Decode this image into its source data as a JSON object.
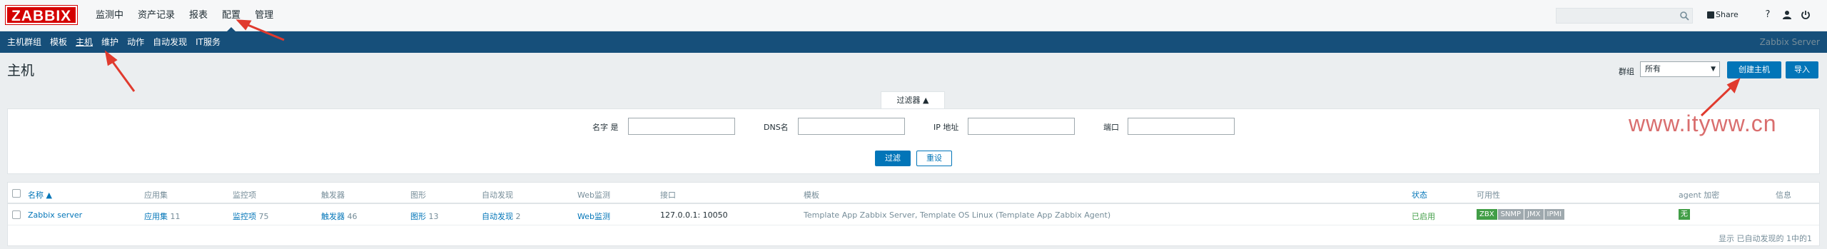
{
  "app": {
    "logo": "ZABBIX",
    "server_name": "Zabbix Server"
  },
  "topnav": [
    {
      "label": "监测中"
    },
    {
      "label": "资产记录"
    },
    {
      "label": "报表"
    },
    {
      "label": "配置",
      "active": true
    },
    {
      "label": "管理"
    }
  ],
  "header_tools": {
    "search_placeholder": "",
    "share_label": "Share",
    "help_icon": "?",
    "user_icon": "user-icon",
    "power_icon": "power-icon"
  },
  "subnav": [
    {
      "label": "主机群组"
    },
    {
      "label": "模板"
    },
    {
      "label": "主机",
      "active": true
    },
    {
      "label": "维护"
    },
    {
      "label": "动作"
    },
    {
      "label": "自动发现"
    },
    {
      "label": "IT服务"
    }
  ],
  "page": {
    "title": "主机",
    "group_label": "群组",
    "group_value": "所有",
    "create_button": "创建主机",
    "import_button": "导入"
  },
  "filter": {
    "tab_label": "过滤器 ▲",
    "name_label": "名字 是",
    "dns_label": "DNS名",
    "ip_label": "IP 地址",
    "port_label": "端口",
    "name_value": "",
    "dns_value": "",
    "ip_value": "",
    "port_value": "",
    "apply_button": "过滤",
    "reset_button": "重设"
  },
  "table": {
    "headers": {
      "name": "名称 ▲",
      "apps": "应用集",
      "items": "监控项",
      "triggers": "触发器",
      "graphs": "图形",
      "discovery": "自动发现",
      "web": "Web监测",
      "interface": "接口",
      "templates": "模板",
      "status": "状态",
      "availability": "可用性",
      "agent_encryption": "agent 加密",
      "info": "信息"
    },
    "rows": [
      {
        "name": "Zabbix server",
        "apps_label": "应用集",
        "apps_count": "11",
        "items_label": "监控项",
        "items_count": "75",
        "triggers_label": "触发器",
        "triggers_count": "46",
        "graphs_label": "图形",
        "graphs_count": "13",
        "discovery_label": "自动发现",
        "discovery_count": "2",
        "web_label": "Web监测",
        "interface": "127.0.0.1: 10050",
        "templates": "Template App Zabbix Server, Template OS Linux (Template App Zabbix Agent)",
        "status": "已启用",
        "availability": [
          "ZBX",
          "SNMP",
          "JMX",
          "IPMI"
        ],
        "encryption": "无"
      }
    ],
    "footer": "显示 已自动发现的 1中的1"
  },
  "watermark": "www.ityww.cn",
  "colors": {
    "brand": "#d40000",
    "subnav": "#164f7a",
    "accent": "#0275b8",
    "enabled": "#429e47",
    "annotation": "#e03a2e"
  }
}
